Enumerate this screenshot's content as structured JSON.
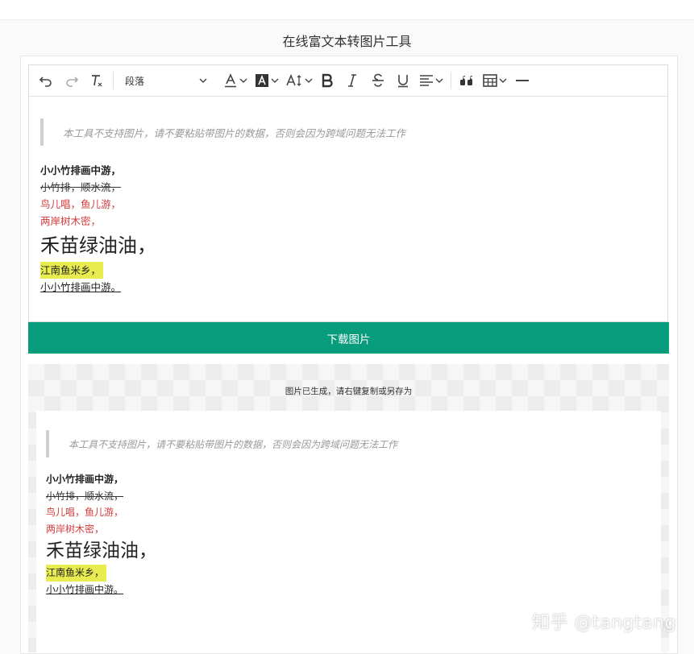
{
  "page": {
    "title": "在线富文本转图片工具"
  },
  "toolbar": {
    "paragraph_format": "段落",
    "icons": [
      "undo-icon",
      "redo-icon",
      "clear-format-icon",
      "font-color-icon",
      "background-color-icon",
      "font-size-icon",
      "bold-icon",
      "italic-icon",
      "strikethrough-icon",
      "underline-icon",
      "align-icon",
      "blockquote-icon",
      "table-icon",
      "divider-icon"
    ]
  },
  "editor": {
    "quote": "本工具不支持图片，请不要粘贴带图片的数据，否则会因为跨域问题无法工作",
    "lines": {
      "bold": "小小竹排画中游，",
      "strike": "小竹排，顺水流，",
      "red1": "鸟儿唱，鱼儿游，",
      "red2": "两岸树木密，",
      "big": "禾苗绿油油，",
      "highlight": "江南鱼米乡，",
      "underline": "小小竹排画中游。"
    }
  },
  "download_button": "下载图片",
  "preview": {
    "message": "图片已生成，请右键复制或另存为",
    "quote": "本工具不支持图片，请不要粘贴带图片的数据，否则会因为跨域问题无法工作",
    "lines": {
      "bold": "小小竹排画中游，",
      "strike": "小竹排，顺水流，",
      "red1": "鸟儿唱，鱼儿游，",
      "red2": "两岸树木密，",
      "big": "禾苗绿油油，",
      "highlight": "江南鱼米乡，",
      "underline": "小小竹排画中游。"
    }
  },
  "watermark": "知乎 @tangtang",
  "colors": {
    "accent": "#079c7c",
    "red_text": "#d23b3b",
    "highlight": "#e8ec4f"
  }
}
